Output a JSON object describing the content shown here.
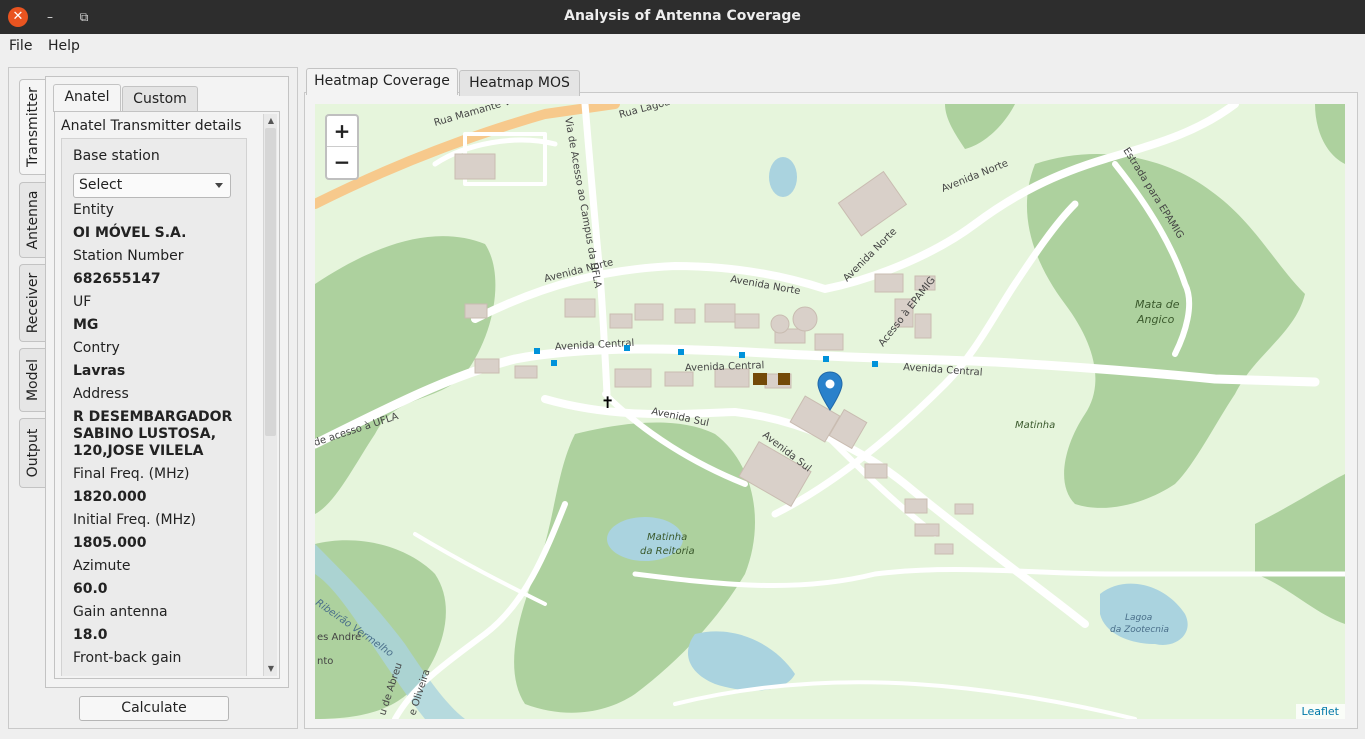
{
  "window": {
    "title": "Analysis of Antenna Coverage",
    "close": "✕",
    "minimize": "–",
    "maximize": "⧉"
  },
  "menu": {
    "file": "File",
    "help": "Help"
  },
  "side_tabs": [
    "Transmitter",
    "Antenna",
    "Receiver",
    "Model",
    "Output"
  ],
  "inner_tabs": [
    "Anatel",
    "Custom"
  ],
  "details": {
    "group_title": "Anatel Transmitter details",
    "base_station_label": "Base station",
    "base_station_select": "Select",
    "entity_label": "Entity",
    "entity_value": "OI MÓVEL S.A.",
    "station_number_label": "Station Number",
    "station_number_value": "682655147",
    "uf_label": "UF",
    "uf_value": "MG",
    "contry_label": "Contry",
    "contry_value": "Lavras",
    "address_label": "Address",
    "address_line1": "R DESEMBARGADOR",
    "address_line2": "SABINO LUSTOSA,",
    "address_line3": "120,JOSE VILELA",
    "final_freq_label": "Final Freq. (MHz)",
    "final_freq_value": "1820.000",
    "initial_freq_label": "Initial Freq. (MHz)",
    "initial_freq_value": "1805.000",
    "azimute_label": "Azimute",
    "azimute_value": "60.0",
    "gain_label": "Gain antenna",
    "gain_value": "18.0",
    "front_back_label": "Front-back gain"
  },
  "calculate_button": "Calculate",
  "map_tabs": [
    "Heatmap Coverage",
    "Heatmap MOS"
  ],
  "map": {
    "zoom_in": "+",
    "zoom_out": "−",
    "attribution": "Leaflet",
    "labels": {
      "rua_mamante": "Rua Mamante Vit",
      "rua_lagoa": "Rua Lagoa",
      "via_acesso": "Via de Acesso ao Campus da UFLA",
      "avenida_norte_1": "Avenida Norte",
      "avenida_norte_2": "Avenida Norte",
      "avenida_norte_3": "Avenida Norte",
      "avenida_norte_4": "Avenida Norte",
      "estrada_epamig": "Estrada para EPAMIG",
      "acesso_epamig": "Acesso à EPAMIG",
      "avenida_central_1": "Avenida Central",
      "avenida_central_2": "Avenida Central",
      "avenida_central_3": "Avenida Central",
      "avenida_sul_1": "Avenida Sul",
      "avenida_sul_2": "Avenida Sul",
      "acesso_ufla": "de acesso à UFLA",
      "mata_angico_1": "Mata de",
      "mata_angico_2": "Angico",
      "matinha": "Matinha",
      "matinha_reitoria_1": "Matinha",
      "matinha_reitoria_2": "da Reitoria",
      "lagoa_zootecnia_1": "Lagoa",
      "lagoa_zootecnia_2": "da Zootecnia",
      "ribeirao": "Ribeirão Vermelho",
      "des_andre": "es André",
      "nto": "nto",
      "de_abreu": "u de Abreu",
      "de_oliveira": "e Oliveira"
    },
    "colors": {
      "background": "#e6f5dc",
      "forest": "#add19e",
      "road": "#ffffff",
      "water": "#aad3df",
      "building": "#d9d0c9",
      "marker": "#2a81cb"
    }
  }
}
